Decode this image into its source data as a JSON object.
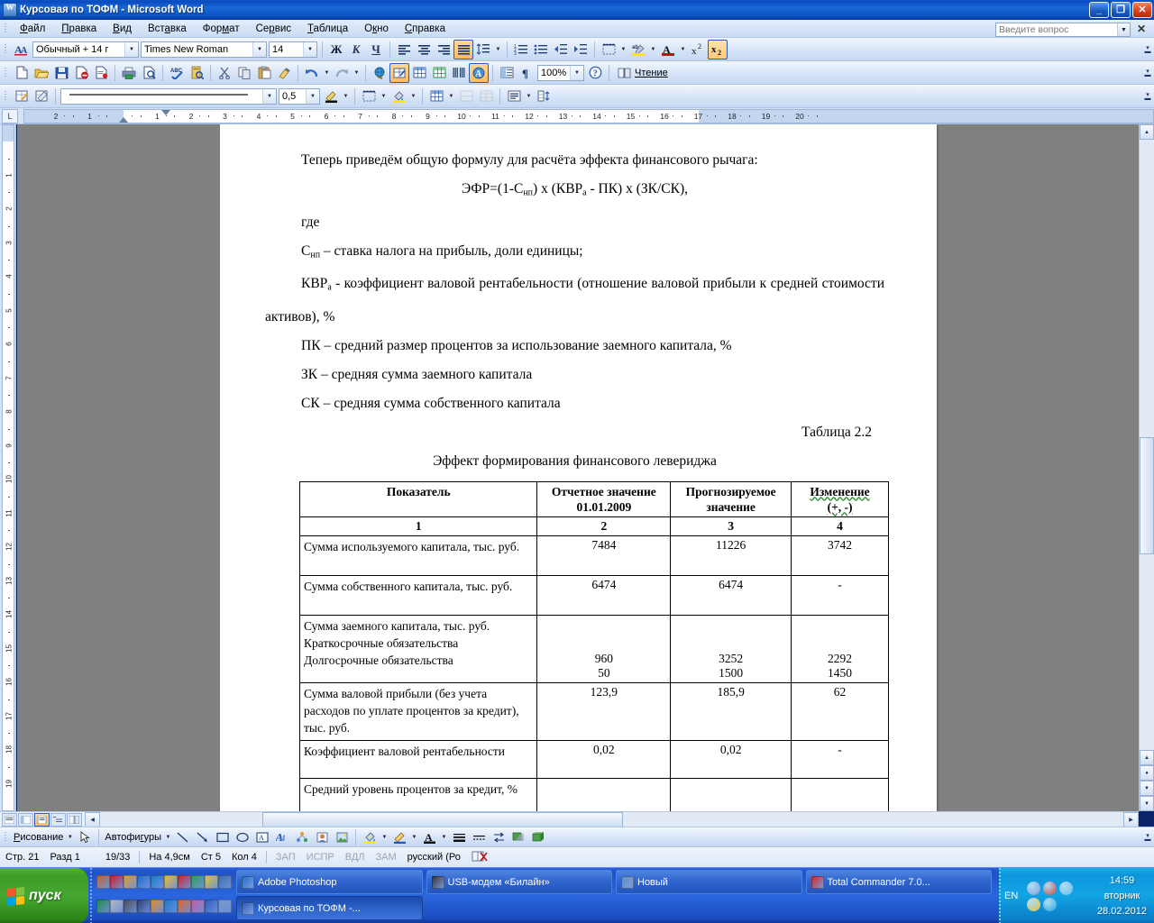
{
  "window": {
    "title": "Курсовая по ТОФМ - Microsoft Word",
    "app_icon": "word-document-icon",
    "minimize": "_",
    "maximize": "❐",
    "close": "✕"
  },
  "menu": {
    "items": [
      "Файл",
      "Правка",
      "Вид",
      "Вставка",
      "Формат",
      "Сервис",
      "Таблица",
      "Окно",
      "Справка"
    ],
    "ask_placeholder": "Введите вопрос",
    "close_label": "✕"
  },
  "formatting_toolbar": {
    "style_value": "Обычный + 14 г",
    "font_value": "Times New Roman",
    "size_value": "14",
    "bold": "Ж",
    "italic": "К",
    "underline": "Ч",
    "align_left": "align-left-icon",
    "align_center": "align-center-icon",
    "align_right": "align-right-icon",
    "align_justify": "align-justify-icon",
    "line_spacing": "line-spacing-icon",
    "numbered_list": "numbered-list-icon",
    "bullet_list": "bullet-list-icon",
    "decrease_indent": "decrease-indent-icon",
    "increase_indent": "increase-indent-icon",
    "borders": "borders-icon",
    "highlight": "highlight-icon",
    "font_color": "font-color-icon",
    "superscript": "x²",
    "subscript": "x₂"
  },
  "standard_toolbar": {
    "zoom_value": "100%",
    "reading_label": "Чтение",
    "buttons": [
      "new-document-icon",
      "open-folder-icon",
      "save-disk-icon",
      "email-icon",
      "print-permission-icon",
      "print-icon",
      "print-preview-icon",
      "spellcheck-abc-icon",
      "research-icon",
      "cut-scissors-icon",
      "copy-icon",
      "paste-icon",
      "format-painter-icon",
      "undo-arrow-icon",
      "redo-arrow-icon",
      "hyperlink-globe-icon",
      "tables-borders-icon",
      "insert-table-icon",
      "insert-excel-icon",
      "columns-icon",
      "drawing-icon",
      "document-map-icon",
      "show-formatting-icon",
      "help-icon"
    ]
  },
  "tables_toolbar": {
    "line_weight": "0,5",
    "buttons": [
      "draw-table-icon",
      "eraser-icon",
      "line-style-icon",
      "line-weight-icon",
      "border-color-icon",
      "borders-icon",
      "shading-color-icon",
      "insert-table-icon",
      "merge-cells-icon",
      "split-cells-icon",
      "align-cell-icon",
      "distribute-rows-icon"
    ]
  },
  "ruler": {
    "horizontal_ticks": [
      "2",
      "1",
      "1",
      "2",
      "3",
      "4",
      "5",
      "6",
      "7",
      "8",
      "9",
      "10",
      "11",
      "12",
      "13",
      "14",
      "15",
      "16",
      "17",
      "18"
    ],
    "vertical_ticks": [
      "1",
      "2",
      "3",
      "4",
      "5",
      "6",
      "7",
      "8",
      "9",
      "10",
      "11",
      "12",
      "13",
      "14",
      "15",
      "16",
      "17",
      "18"
    ]
  },
  "document": {
    "paragraphs": [
      "Теперь приведём общую формулу для расчёта эффекта финансового рычага:",
      "где"
    ],
    "formula": "ЭФР=(1-Снп) х (КВРа - ПК) х (ЗК/СК),",
    "formula_parts": {
      "prefix": "ЭФР=(1-С",
      "sub1": "нп",
      "mid": ") х (КВР",
      "sub2": "а",
      "suffix": " - ПК) х (ЗК/СК),"
    },
    "definitions": [
      {
        "symbol": "С",
        "sub": "нп",
        "text": " – ставка налога на прибыль, доли единицы;"
      },
      {
        "symbol": "КВР",
        "sub": "а",
        "text": " - коэффициент валовой рентабельности (отношение валовой прибыли к средней стоимости активов), %"
      },
      {
        "symbol": "ПК",
        "sub": "",
        "text": " – средний размер процентов за использование заемного капитала, %"
      },
      {
        "symbol": "ЗК",
        "sub": "",
        "text": " – средняя сумма заемного капитала"
      },
      {
        "symbol": "СК",
        "sub": "",
        "text": " – средняя сумма собственного капитала"
      }
    ],
    "table_number": "Таблица 2.2",
    "table_caption": "Эффект формирования финансового левериджа",
    "table": {
      "headers": [
        {
          "line1": "Показатель",
          "line2": ""
        },
        {
          "line1": "Отчетное значение",
          "line2": "01.01.2009"
        },
        {
          "line1": "Прогнозируемое",
          "line2": "значение"
        },
        {
          "line1": "Изменение",
          "line2": "(+, -)"
        }
      ],
      "number_row": [
        "1",
        "2",
        "3",
        "4"
      ],
      "rows": [
        {
          "label": "Сумма используемого капитала, тыс. руб.",
          "c2": "7484",
          "c3": "11226",
          "c4": "3742"
        },
        {
          "label": "Сумма собственного капитала, тыс. руб.",
          "c2": "6474",
          "c3": "6474",
          "c4": "-"
        },
        {
          "label": "Сумма заемного капитала, тыс. руб.",
          "sub_lines": [
            "Краткосрочные обязательства",
            "Долгосрочные обязательства"
          ],
          "c2_lines": [
            "960",
            "50"
          ],
          "c3_lines": [
            "3252",
            "1500"
          ],
          "c4_lines": [
            "2292",
            "1450"
          ]
        },
        {
          "label": "Сумма валовой прибыли (без учета расходов по уплате процентов за кредит), тыс. руб.",
          "c2": "123,9",
          "c3": "185,9",
          "c4": "62"
        },
        {
          "label": "Коэффициент валовой рентабельности",
          "c2": "0,02",
          "c3": "0,02",
          "c4": "-"
        },
        {
          "label": "Средний уровень процентов за кредит, %",
          "c2": "",
          "c3": "",
          "c4": ""
        }
      ]
    }
  },
  "drawing_toolbar": {
    "menu_label": "Рисование",
    "autoshapes_label": "Автофигуры",
    "tools": [
      "select-arrow-icon",
      "line-icon",
      "arrow-icon",
      "rectangle-icon",
      "oval-icon",
      "text-box-icon",
      "wordart-icon",
      "diagram-icon",
      "clipart-icon",
      "picture-icon",
      "fill-color-icon",
      "line-color-icon",
      "font-color-icon",
      "line-style-icon",
      "dash-style-icon",
      "arrow-style-icon",
      "shadow-style-icon",
      "3d-style-icon"
    ]
  },
  "status_bar": {
    "page": "Стр. 21",
    "section": "Разд 1",
    "page_count": "19/33",
    "at": "На 4,9см",
    "line": "Ст 5",
    "column": "Кол 4",
    "rec": "ЗАП",
    "trk": "ИСПР",
    "ext": "ВДЛ",
    "ovr": "ЗАМ",
    "language": "русский (Ро",
    "spell_icon": "spelling-status-icon"
  },
  "view_buttons": [
    "normal-view-icon",
    "web-layout-view-icon",
    "print-layout-view-icon",
    "outline-view-icon",
    "reading-view-icon"
  ],
  "taskbar": {
    "start_label": "пуск",
    "quick_launch": [
      {
        "name": "quicklaunch-icon-tank",
        "color": "#C8621E"
      },
      {
        "name": "quicklaunch-icon-opera",
        "color": "#D81818"
      },
      {
        "name": "quicklaunch-icon-winamp",
        "color": "#E8A020"
      },
      {
        "name": "quicklaunch-icon-ie",
        "color": "#1C6CC8"
      },
      {
        "name": "quicklaunch-icon-teamviewer",
        "color": "#1878C8"
      },
      {
        "name": "quicklaunch-icon-sun",
        "color": "#F0C020"
      },
      {
        "name": "quicklaunch-icon-phone",
        "color": "#D02020"
      },
      {
        "name": "quicklaunch-icon-notepad",
        "color": "#2E9E4E"
      },
      {
        "name": "quicklaunch-icon-paint",
        "color": "#E8C820"
      },
      {
        "name": "quicklaunch-icon-brush",
        "color": "#3C6CA8"
      },
      {
        "name": "quicklaunch-icon-excel",
        "color": "#1E8A3E"
      },
      {
        "name": "quicklaunch-icon-save",
        "color": "#B8B8B8"
      },
      {
        "name": "quicklaunch-icon-lightroom",
        "color": "#4A4A4A"
      },
      {
        "name": "quicklaunch-icon-nero",
        "color": "#2C3C6C"
      },
      {
        "name": "quicklaunch-icon-clock",
        "color": "#E88818"
      },
      {
        "name": "quicklaunch-icon-player",
        "color": "#1878C8"
      },
      {
        "name": "quicklaunch-icon-firefox",
        "color": "#E86018"
      },
      {
        "name": "quicklaunch-icon-key",
        "color": "#C85898"
      },
      {
        "name": "quicklaunch-icon-word",
        "color": "#2C5CB8"
      },
      {
        "name": "quicklaunch-icon-doc",
        "color": "#7898C8"
      }
    ],
    "buttons": [
      {
        "label": "Adobe Photoshop",
        "icon": "photoshop-icon",
        "icon_color": "#1C6CC8",
        "active": false
      },
      {
        "label": "USB-модем «Билайн»",
        "icon": "modem-icon",
        "icon_color": "#303030",
        "active": false
      },
      {
        "label": "Новый",
        "icon": "globe-icon",
        "icon_color": "#5A8AC0",
        "active": false
      },
      {
        "label": "Total Commander 7.0...",
        "icon": "total-commander-icon",
        "icon_color": "#D02020",
        "active": false
      },
      {
        "label": "Курсовая по ТОФМ -...",
        "icon": "word-icon",
        "icon_color": "#2C5CB8",
        "active": true
      }
    ],
    "tray": {
      "language": "EN",
      "icons": [
        "network-icon",
        "volume-mute-icon",
        "show-hidden-icon",
        "antivirus-icon",
        "update-icon"
      ],
      "time": "14:59",
      "weekday": "вторник",
      "date": "28.02.2012"
    }
  }
}
